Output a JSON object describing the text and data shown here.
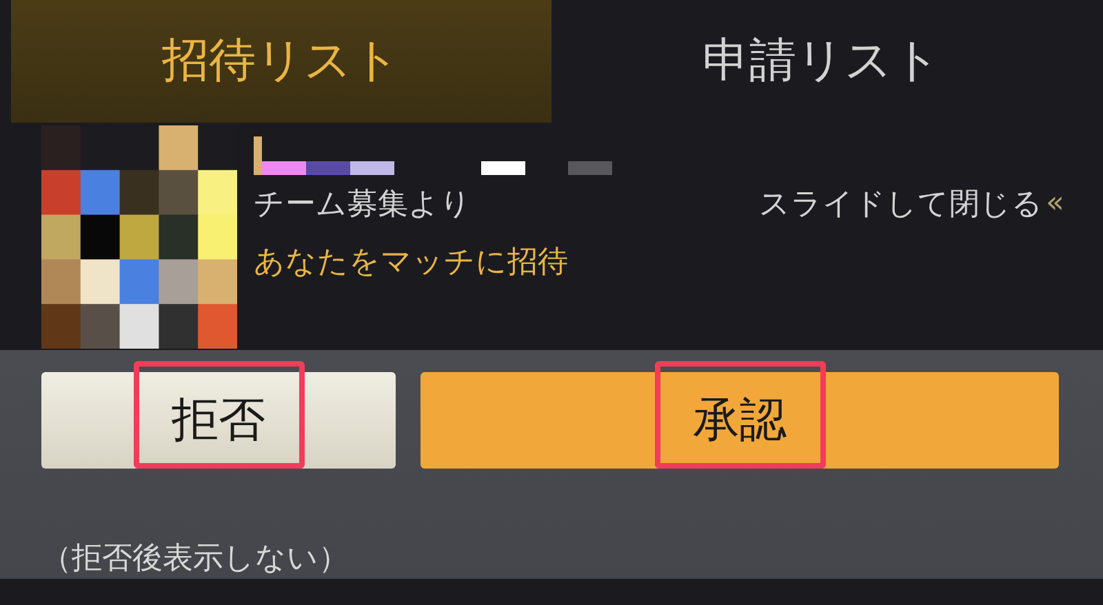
{
  "tabs": [
    {
      "label": "招待リスト",
      "selected": true
    },
    {
      "label": "申請リスト",
      "selected": false
    }
  ],
  "invite": {
    "source": "チーム募集より",
    "hint": "スライドして閉じる",
    "hint_icon": "«",
    "message": "あなたをマッチに招待"
  },
  "buttons": [
    {
      "label": "拒否",
      "kind": "decline",
      "highlighted": true
    },
    {
      "label": "承認",
      "kind": "accept",
      "highlighted": true
    }
  ],
  "note": "（拒否後表示しない）"
}
